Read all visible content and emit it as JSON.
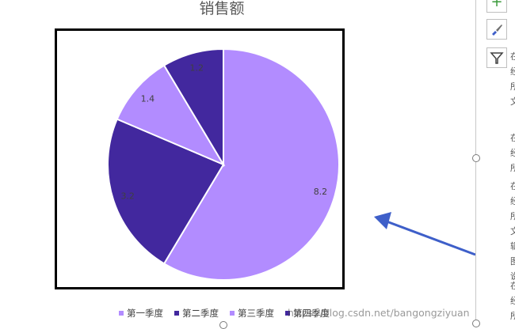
{
  "chart_data": {
    "type": "pie",
    "title": "销售额",
    "categories": [
      "第一季度",
      "第二季度",
      "第三季度",
      "第四季度"
    ],
    "values": [
      8.2,
      3.2,
      1.4,
      1.2
    ],
    "data_labels": [
      "8.2",
      "3.2",
      "1.4",
      "1.2"
    ],
    "colors": [
      "#b28cff",
      "#42289e",
      "#b28cff",
      "#42289e"
    ],
    "legend_position": "bottom"
  },
  "legend": {
    "items": [
      {
        "label": "第一季度",
        "color": "#b28cff"
      },
      {
        "label": "第二季度",
        "color": "#42289e"
      },
      {
        "label": "第三季度",
        "color": "#b28cff"
      },
      {
        "label": "第四季度",
        "color": "#42289e"
      }
    ]
  },
  "watermark": "https://blog.csdn.net/bangongziyuan",
  "side_panel": {
    "tools": [
      "plus-icon",
      "brush-icon",
      "filter-icon"
    ],
    "text_fragments": [
      "在",
      "经",
      "所",
      "文",
      "在",
      "经",
      "所",
      "在",
      "经",
      "所",
      "文",
      "辑",
      "图",
      "说",
      "在",
      "经",
      "所"
    ]
  },
  "annotation": {
    "arrow_color": "#3e5fc9"
  }
}
